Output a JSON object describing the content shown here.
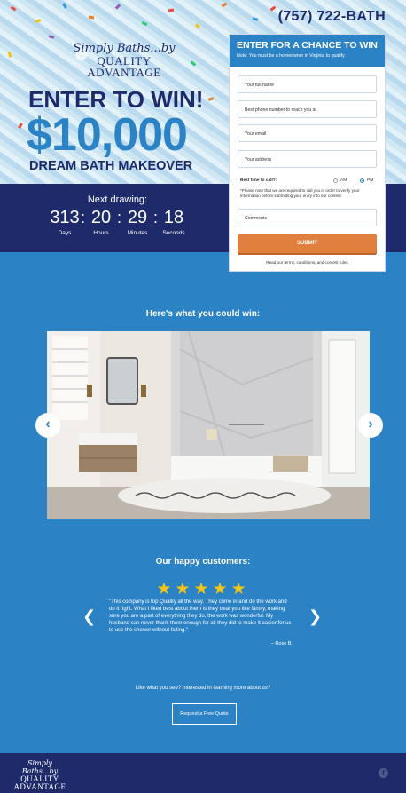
{
  "header": {
    "phone": "(757) 722-BATH"
  },
  "logo": {
    "script": "Simply Baths...by",
    "main_line1": "QUALITY",
    "main_line2": "ADVANTAGE"
  },
  "hero": {
    "enter": "ENTER TO WIN!",
    "amount": "$10,000",
    "makeover": "DREAM BATH MAKEOVER"
  },
  "countdown": {
    "label": "Next drawing:",
    "units": [
      {
        "value": "313",
        "label": "Days"
      },
      {
        "value": "20",
        "label": "Hours"
      },
      {
        "value": "29",
        "label": "Minutes"
      },
      {
        "value": "18",
        "label": "Seconds"
      }
    ]
  },
  "form": {
    "title": "ENTER FOR A CHANCE TO WIN",
    "note": "Note: You must be a homeowner in Virginia to qualify.",
    "fields": {
      "name": "Your full name",
      "phone": "Best phone number to reach you at",
      "email": "Your email",
      "address": "Your address",
      "comments": "Comments"
    },
    "best_time_label": "Best time to call?:",
    "options": [
      "AM",
      "PM"
    ],
    "selected": "PM",
    "disclaimer": "*Please note that we are required to call you in order to verify your information before submitting your entry into our contest.",
    "submit": "SUBMIT",
    "terms": "Read our terms, conditions, and contest rules"
  },
  "gallery": {
    "title": "Here's what you could win:",
    "prev": "‹",
    "next": "›"
  },
  "testimonials": {
    "title": "Our happy customers:",
    "stars": 5,
    "quote": "\"This company is top Quality all the way. They come in and do the work and do it right. What I liked best about them is they treat you like family, making sure you are a part of everything they do, the work was wonderful. My husband can never thank them enough for all they did to make it easier for us to use the shower without falling.\"",
    "author": "– Rose B."
  },
  "cta": {
    "question": "Like what you see? Interested in learning more about us?",
    "button": "Request a Free Quote"
  },
  "footer": {
    "facebook": "f"
  },
  "colors": {
    "navy": "#1f2a6b",
    "blue": "#2b82c4",
    "orange": "#e07f3e",
    "star": "#f0c419"
  }
}
